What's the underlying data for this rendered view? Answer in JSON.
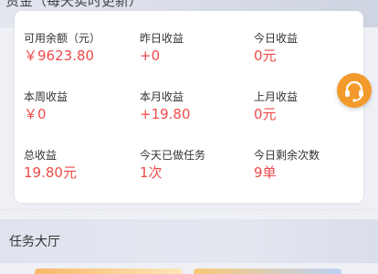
{
  "header": {
    "title_partial": "资金（每天实时更新）"
  },
  "stats": [
    {
      "label": "可用余额（元）",
      "value": "￥9623.80"
    },
    {
      "label": "昨日收益",
      "value": "+0"
    },
    {
      "label": "今日收益",
      "value": "0元"
    },
    {
      "label": "本周收益",
      "value": "￥0"
    },
    {
      "label": "本月收益",
      "value": "+19.80"
    },
    {
      "label": "上月收益",
      "value": "0元"
    },
    {
      "label": "总收益",
      "value": "19.80元"
    },
    {
      "label": "今天已做任务",
      "value": "1次"
    },
    {
      "label": "今日剩余次数",
      "value": "9单"
    }
  ],
  "task_section": {
    "title": "任务大厅"
  },
  "icons": {
    "customer_service": "headset-icon"
  },
  "colors": {
    "value_red": "#ef4a4a",
    "service_orange": "#f39a2c"
  }
}
